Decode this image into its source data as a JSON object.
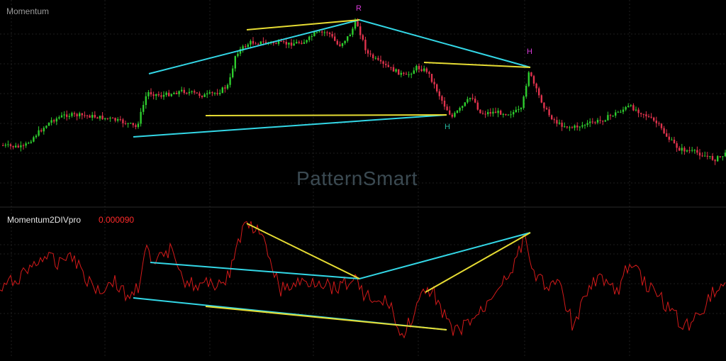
{
  "main_panel": {
    "title": "Momentum"
  },
  "indicator_panel": {
    "title": "Momentum2DIVpro",
    "value": "0.000090"
  },
  "watermark": "PatternSmart",
  "pattern_labels": {
    "left_shoulder": "H",
    "head": "R",
    "right_shoulder": "H"
  },
  "colors": {
    "background": "#000000",
    "grid": "#1e1e1e",
    "separator": "#2a2a2a",
    "bull_candle": "#2ecc2e",
    "bear_candle": "#e0334d",
    "pattern_line_cyan": "#33d7e6",
    "pattern_line_yellow": "#e6dc33",
    "indicator_line": "#d41a1a",
    "label_magenta": "#d93ad9",
    "label_teal": "#25b8a0"
  }
}
